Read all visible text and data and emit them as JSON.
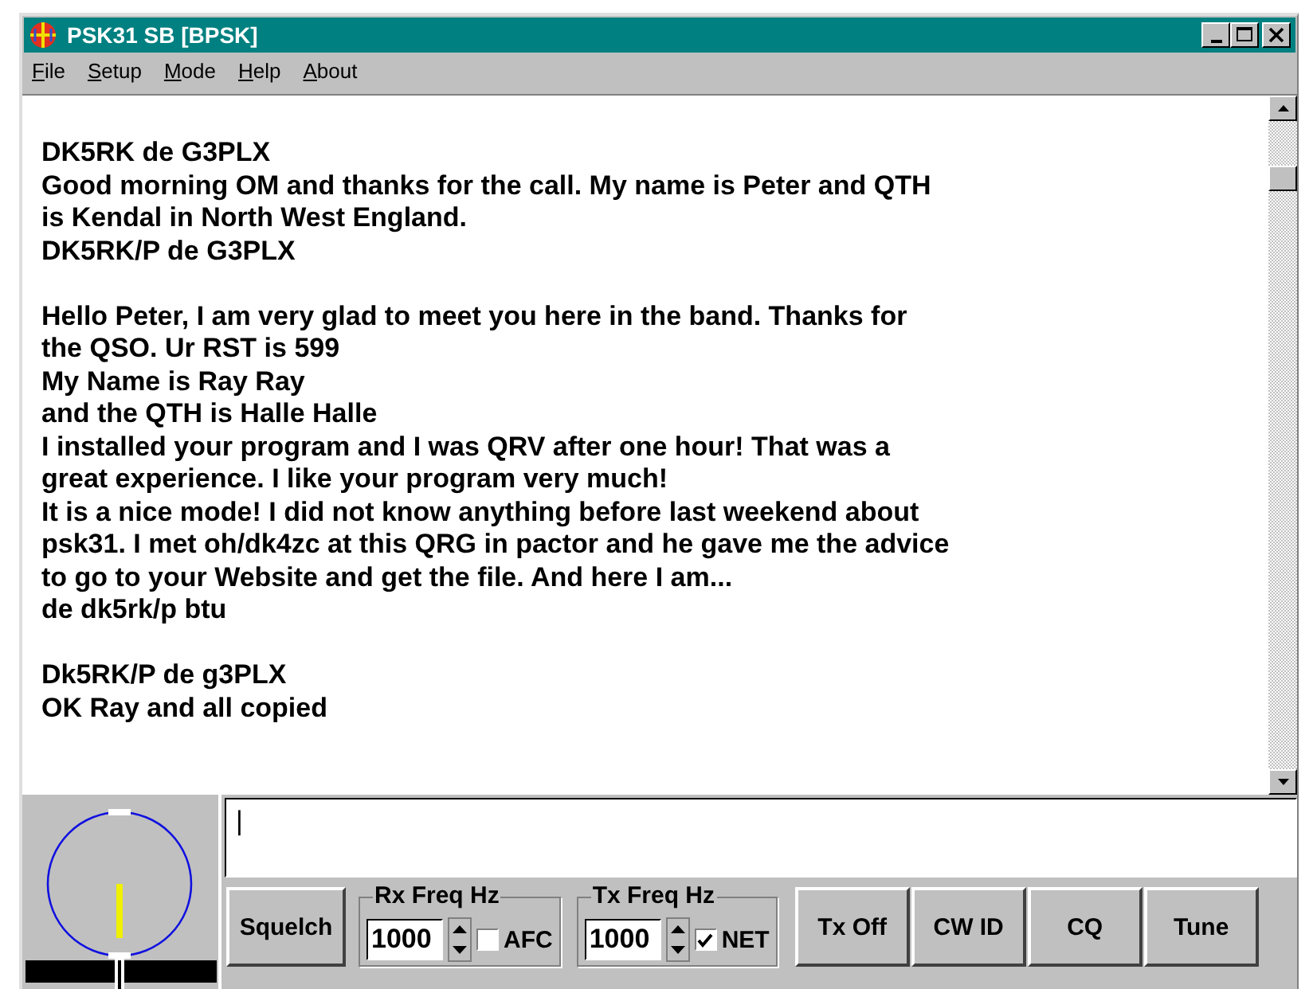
{
  "window": {
    "title": "PSK31 SB [BPSK]"
  },
  "menu": [
    {
      "label": "File"
    },
    {
      "label": "Setup"
    },
    {
      "label": "Mode"
    },
    {
      "label": "Help"
    },
    {
      "label": "About"
    }
  ],
  "receive_text": [
    [
      "DK5RK de G3PLX",
      "Good morning OM and thanks for the call. My name is Peter and QTH",
      "is Kendal in North West England.",
      "DK5RK/P de G3PLX"
    ],
    [
      "Hello Peter, I am very glad to meet you here in the band. Thanks for",
      "the QSO. Ur RST is 599",
      "My Name is Ray Ray",
      "and the QTH is Halle Halle",
      "I installed your program and I was QRV after one hour! That was a",
      "great experience. I like your program very much!",
      "It is a nice mode! I did not know anything before last weekend about",
      "psk31. I met oh/dk4zc at this QRG in pactor and he gave me the advice",
      "to go to your Website and get the file. And here I am...",
      "de dk5rk/p btu"
    ],
    [
      "Dk5RK/P de g3PLX",
      "OK Ray and all copied"
    ]
  ],
  "transmit_text": {
    "value": "|"
  },
  "squelch_button": "Squelch",
  "rx_freq": {
    "label": "Rx Freq Hz",
    "value": "1000",
    "option": {
      "label": "AFC",
      "checked": false
    }
  },
  "tx_freq": {
    "label": "Tx Freq Hz",
    "value": "1000",
    "option": {
      "label": "NET",
      "checked": true
    }
  },
  "buttons": [
    "Tx Off",
    "CW ID",
    "CQ",
    "Tune"
  ]
}
